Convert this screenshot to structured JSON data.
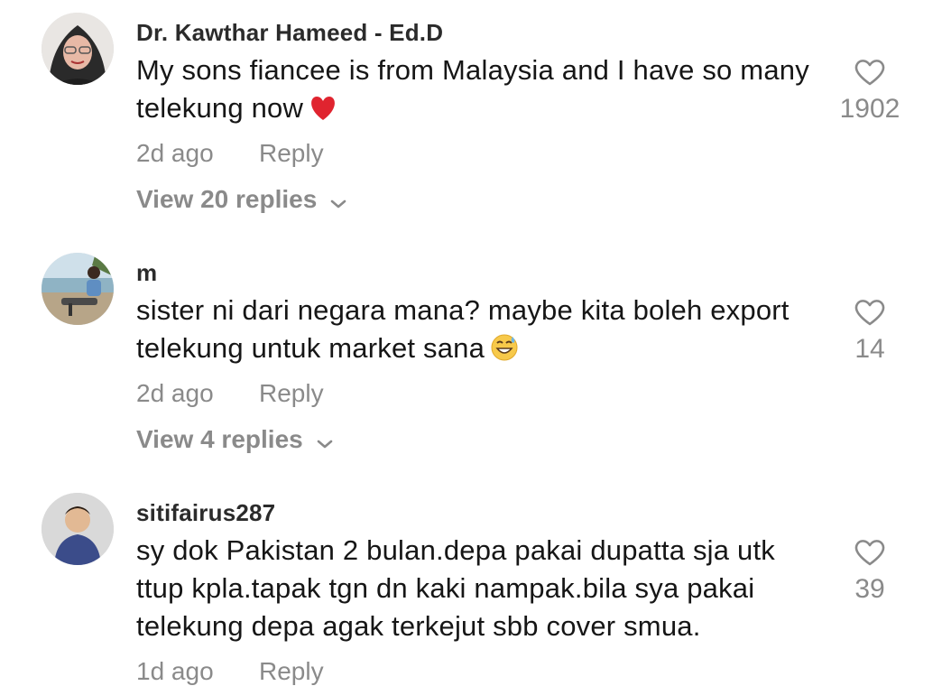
{
  "comments": [
    {
      "username": "Dr. Kawthar Hameed - Ed.D",
      "text": "My sons fiancee is from Malaysia and I have so many telekung now",
      "emoji": "red-heart-emoji",
      "time": "2d ago",
      "reply_label": "Reply",
      "view_replies": "View 20 replies",
      "likes": "1902"
    },
    {
      "username": "m",
      "text": "sister ni dari negara mana? maybe kita boleh export telekung untuk market sana",
      "emoji": "grinning-sweat-emoji",
      "time": "2d ago",
      "reply_label": "Reply",
      "view_replies": "View 4 replies",
      "likes": "14"
    },
    {
      "username": "sitifairus287",
      "text": "sy dok Pakistan 2 bulan.depa pakai dupatta sja utk ttup kpla.tapak tgn dn kaki nampak.bila sya pakai telekung depa agak terkejut sbb cover smua.",
      "time": "1d ago",
      "reply_label": "Reply",
      "likes": "39"
    }
  ],
  "colors": {
    "text": "#161616",
    "muted": "#8a8a8a",
    "heart_red": "#e0242f"
  }
}
